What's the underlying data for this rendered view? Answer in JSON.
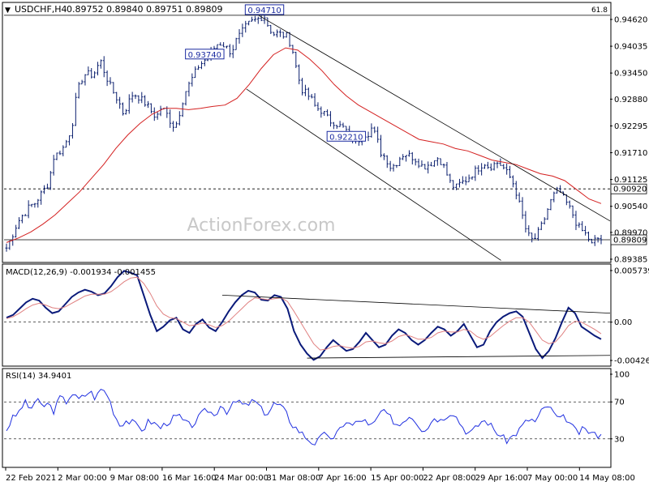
{
  "header": {
    "symbol": "USDCHF,H4",
    "ohlc": "0.89752 0.89840 0.89751 0.89809"
  },
  "watermark": "ActionForex.com",
  "colors": {
    "bars": "#0b1f6e",
    "ema": "#d42020",
    "macd_line": "#0a1a7a",
    "macd_signal": "#e08080",
    "rsi_line": "#2030e0",
    "grid": "#000000",
    "tag_border": "#1a2aa0",
    "price_tag_bg": "#ffffff"
  },
  "chart_data": [
    {
      "type": "ohlc",
      "panel": "price",
      "y_ticks": [
        "0.94620",
        "0.94035",
        "0.93450",
        "0.92880",
        "0.92295",
        "0.91710",
        "0.91125",
        "0.90540",
        "0.89970",
        "0.89385"
      ],
      "ylim": [
        0.89385,
        0.9462
      ],
      "levels": [
        {
          "value": 0.9471,
          "label": "0.94710",
          "style": "solid"
        },
        {
          "value": 0.9092,
          "label": "0.90920",
          "style": "dashed"
        },
        {
          "value": 0.89809,
          "label": "0.89809",
          "style": "solid"
        }
      ],
      "fib_label": "61.8",
      "annotations": [
        {
          "label": "0.94710",
          "value": 0.9471,
          "marks": "high"
        },
        {
          "label": "0.93740",
          "value": 0.9374,
          "marks": "high"
        },
        {
          "label": "0.92210",
          "value": 0.9221,
          "marks": "low"
        }
      ],
      "price_path": [
        0.8963,
        0.8985,
        0.901,
        0.903,
        0.904,
        0.9055,
        0.906,
        0.9075,
        0.909,
        0.9105,
        0.916,
        0.917,
        0.918,
        0.92,
        0.923,
        0.93,
        0.933,
        0.9345,
        0.934,
        0.9348,
        0.9374,
        0.9345,
        0.932,
        0.93,
        0.9282,
        0.9255,
        0.928,
        0.93,
        0.9295,
        0.9285,
        0.9275,
        0.926,
        0.9248,
        0.927,
        0.926,
        0.924,
        0.9225,
        0.926,
        0.93,
        0.932,
        0.934,
        0.936,
        0.937,
        0.938,
        0.9395,
        0.9408,
        0.941,
        0.94,
        0.939,
        0.9415,
        0.943,
        0.9445,
        0.9455,
        0.946,
        0.9465,
        0.9471,
        0.9445,
        0.943,
        0.9432,
        0.9428,
        0.9425,
        0.94,
        0.935,
        0.931,
        0.93,
        0.929,
        0.927,
        0.9265,
        0.9255,
        0.924,
        0.9238,
        0.923,
        0.9225,
        0.9215,
        0.92,
        0.9195,
        0.9215,
        0.921,
        0.9225,
        0.9205,
        0.917,
        0.916,
        0.914,
        0.9145,
        0.916,
        0.917,
        0.9165,
        0.916,
        0.915,
        0.914,
        0.9145,
        0.915,
        0.916,
        0.915,
        0.9125,
        0.91,
        0.9095,
        0.9105,
        0.911,
        0.912,
        0.913,
        0.914,
        0.915,
        0.914,
        0.9145,
        0.915,
        0.914,
        0.9125,
        0.911,
        0.908,
        0.904,
        0.9,
        0.898,
        0.8985,
        0.9005,
        0.903,
        0.906,
        0.908,
        0.909,
        0.907,
        0.9055,
        0.9035,
        0.901,
        0.9,
        0.899,
        0.897,
        0.8985,
        0.8981
      ],
      "ema_path": [
        0.8975,
        0.8985,
        0.8998,
        0.9015,
        0.9035,
        0.906,
        0.9085,
        0.9115,
        0.9145,
        0.918,
        0.921,
        0.9235,
        0.9255,
        0.9268,
        0.9268,
        0.9265,
        0.9268,
        0.9272,
        0.9275,
        0.929,
        0.932,
        0.9355,
        0.9385,
        0.94,
        0.9395,
        0.9375,
        0.935,
        0.932,
        0.9295,
        0.9275,
        0.926,
        0.9245,
        0.923,
        0.9215,
        0.92,
        0.9195,
        0.919,
        0.918,
        0.9175,
        0.9165,
        0.9155,
        0.915,
        0.9145,
        0.9135,
        0.9125,
        0.912,
        0.911,
        0.909,
        0.907,
        0.906
      ],
      "channel_upper": [
        {
          "x": 0.42,
          "y": 0.9471
        },
        {
          "x": 1.0,
          "y": 0.9022
        }
      ],
      "channel_lower": [
        {
          "x": 0.4,
          "y": 0.931
        },
        {
          "x": 0.82,
          "y": 0.8936
        }
      ]
    },
    {
      "type": "line",
      "panel": "macd",
      "title": "MACD(12,26,9) -0.001934 -0.001455",
      "y_ticks": [
        "0.005739",
        "0.00",
        "-0.004261"
      ],
      "ylim": [
        -0.004261,
        0.005739
      ],
      "series": [
        {
          "name": "MACD",
          "values": [
            0.0005,
            0.0008,
            0.0015,
            0.0022,
            0.0026,
            0.0024,
            0.0016,
            0.001,
            0.0012,
            0.002,
            0.0028,
            0.0033,
            0.0036,
            0.0034,
            0.003,
            0.0032,
            0.004,
            0.005,
            0.0057,
            0.0055,
            0.0052,
            0.003,
            0.0008,
            -0.001,
            -0.0005,
            0.0002,
            0.0005,
            -0.0008,
            -0.0012,
            -0.0002,
            0.0003,
            -0.0006,
            -0.001,
            0.0,
            0.0012,
            0.0022,
            0.003,
            0.0035,
            0.0033,
            0.0025,
            0.0024,
            0.003,
            0.0028,
            0.0015,
            -0.001,
            -0.0025,
            -0.0035,
            -0.0042,
            -0.0038,
            -0.0028,
            -0.002,
            -0.0026,
            -0.0032,
            -0.003,
            -0.0022,
            -0.0012,
            -0.002,
            -0.0028,
            -0.0025,
            -0.0015,
            -0.0008,
            -0.0012,
            -0.002,
            -0.0025,
            -0.002,
            -0.0012,
            -0.0005,
            -0.0008,
            -0.0015,
            -0.001,
            -0.0002,
            -0.0015,
            -0.0028,
            -0.0025,
            -0.001,
            0.0,
            0.0006,
            0.001,
            0.0012,
            0.0006,
            -0.0012,
            -0.003,
            -0.004,
            -0.0032,
            -0.0018,
            0.0,
            0.0016,
            0.001,
            -0.0005,
            -0.001,
            -0.0015,
            -0.0019
          ]
        },
        {
          "name": "Signal",
          "values": [
            0.0004,
            0.0006,
            0.001,
            0.0015,
            0.0019,
            0.0021,
            0.0019,
            0.0016,
            0.0015,
            0.0017,
            0.0021,
            0.0025,
            0.0029,
            0.0031,
            0.0031,
            0.0031,
            0.0034,
            0.0039,
            0.0045,
            0.0049,
            0.005,
            0.0043,
            0.0032,
            0.0018,
            0.0009,
            0.0005,
            0.0004,
            0.0,
            -0.0004,
            -0.0003,
            -0.0001,
            -0.0003,
            -0.0006,
            -0.0004,
            0.0001,
            0.0008,
            0.0015,
            0.0022,
            0.0027,
            0.0026,
            0.0025,
            0.0026,
            0.0027,
            0.0023,
            0.0012,
            0.0,
            -0.0012,
            -0.0024,
            -0.0031,
            -0.003,
            -0.0027,
            -0.0026,
            -0.0028,
            -0.0029,
            -0.0027,
            -0.0022,
            -0.0021,
            -0.0023,
            -0.0024,
            -0.0021,
            -0.0016,
            -0.0014,
            -0.0016,
            -0.0019,
            -0.0019,
            -0.0017,
            -0.0012,
            -0.001,
            -0.0011,
            -0.0011,
            -0.0008,
            -0.001,
            -0.0016,
            -0.0019,
            -0.0016,
            -0.001,
            -0.0004,
            0.0001,
            0.0005,
            0.0005,
            0.0,
            -0.001,
            -0.002,
            -0.0024,
            -0.0022,
            -0.0014,
            -0.0004,
            0.0001,
            0.0,
            -0.0004,
            -0.0008,
            -0.0013
          ]
        }
      ],
      "trendlines": [
        {
          "from": {
            "x": 0.36,
            "y": 0.003
          },
          "to": {
            "x": 1.0,
            "y": 0.001
          }
        },
        {
          "from": {
            "x": 0.5,
            "y": -0.004
          },
          "to": {
            "x": 1.0,
            "y": -0.0037
          }
        }
      ]
    },
    {
      "type": "line",
      "panel": "rsi",
      "title": "RSI(14) 34.9401",
      "y_ticks": [
        "100",
        "70",
        "30"
      ],
      "ylim": [
        0,
        100
      ],
      "levels": [
        70,
        30
      ],
      "series": [
        {
          "name": "RSI(14)",
          "values": [
            40,
            52,
            58,
            70,
            62,
            72,
            65,
            68,
            60,
            75,
            70,
            80,
            72,
            76,
            82,
            74,
            85,
            78,
            60,
            45,
            50,
            48,
            44,
            40,
            50,
            46,
            42,
            48,
            52,
            55,
            47,
            44,
            50,
            58,
            62,
            54,
            68,
            60,
            66,
            72,
            64,
            70,
            70,
            60,
            58,
            68,
            66,
            58,
            46,
            40,
            34,
            28,
            25,
            32,
            36,
            28,
            40,
            50,
            44,
            48,
            52,
            42,
            48,
            60,
            56,
            50,
            44,
            52,
            56,
            48,
            40,
            44,
            54,
            50,
            56,
            60,
            50,
            40,
            36,
            42,
            50,
            48,
            40,
            34,
            28,
            32,
            38,
            46,
            52,
            48,
            60,
            66,
            58,
            50,
            54,
            44,
            36,
            40,
            38,
            34,
            35
          ]
        }
      ]
    }
  ],
  "x_axis_labels": [
    "22 Feb 2021",
    "2 Mar 00:00",
    "9 Mar 08:00",
    "16 Mar 16:00",
    "24 Mar 00:00",
    "31 Mar 08:00",
    "7 Apr 16:00",
    "15 Apr 00:00",
    "22 Apr 08:00",
    "29 Apr 16:00",
    "7 May 00:00",
    "14 May 08:00"
  ]
}
